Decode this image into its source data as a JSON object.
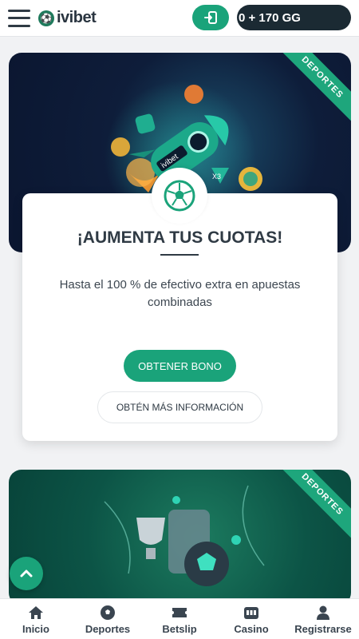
{
  "header": {
    "logo_text": "ivibet",
    "balance": "0 + 170 GG"
  },
  "promo_top": {
    "ribbon": "DEPORTES"
  },
  "offer": {
    "title": "¡AUMENTA TUS CUOTAS!",
    "description": "Hasta el 100 % de efectivo extra en apuestas combinadas",
    "primary_button": "OBTENER BONO",
    "secondary_button": "OBTÉN MÁS INFORMACIÓN"
  },
  "promo_bottom": {
    "ribbon": "DEPORTES"
  },
  "bottom_nav": {
    "items": [
      {
        "label": "Inicio",
        "icon": "home-icon"
      },
      {
        "label": "Deportes",
        "icon": "soccer-ball-icon"
      },
      {
        "label": "Betslip",
        "icon": "ticket-icon"
      },
      {
        "label": "Casino",
        "icon": "slot-machine-icon"
      },
      {
        "label": "Registrarse",
        "icon": "user-icon"
      }
    ]
  },
  "colors": {
    "accent": "#1aa37a",
    "dark": "#1b2a33",
    "promo_navy": "#0e1d3a",
    "promo_green": "#0c5446"
  }
}
